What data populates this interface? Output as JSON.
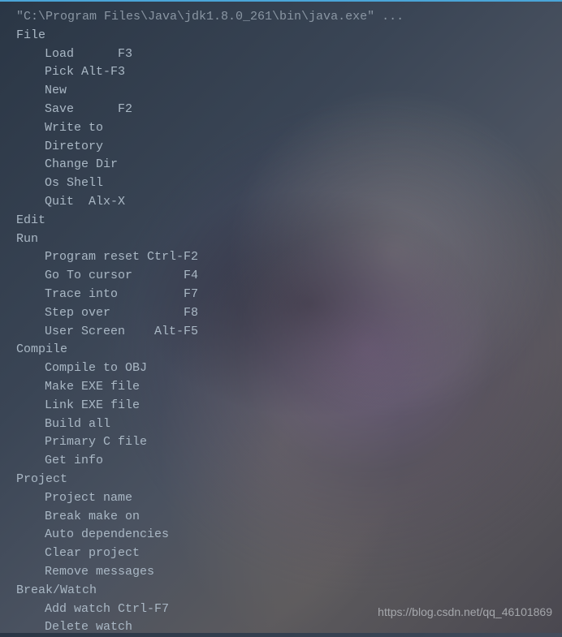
{
  "header": "\"C:\\Program Files\\Java\\jdk1.8.0_261\\bin\\java.exe\" ...",
  "sections": [
    {
      "name": "File",
      "items": [
        {
          "label": "Load",
          "shortcut": "F3",
          "col": 10
        },
        {
          "label": "Pick",
          "shortcut": "Alt-F3",
          "col": 5
        },
        {
          "label": "New",
          "shortcut": "",
          "col": 0
        },
        {
          "label": "Save",
          "shortcut": "F2",
          "col": 10
        },
        {
          "label": "Write to",
          "shortcut": "",
          "col": 0
        },
        {
          "label": "Diretory",
          "shortcut": "",
          "col": 0
        },
        {
          "label": "Change Dir",
          "shortcut": "",
          "col": 0
        },
        {
          "label": "Os Shell",
          "shortcut": "",
          "col": 0
        },
        {
          "label": "Quit",
          "shortcut": "Alx-X",
          "col": 6
        }
      ]
    },
    {
      "name": "Edit",
      "items": []
    },
    {
      "name": "Run",
      "items": [
        {
          "label": "Program reset",
          "shortcut": "Ctrl-F2",
          "col": 14
        },
        {
          "label": "Go To cursor",
          "shortcut": "F4",
          "col": 19
        },
        {
          "label": "Trace into",
          "shortcut": "F7",
          "col": 19
        },
        {
          "label": "Step over",
          "shortcut": "F8",
          "col": 19
        },
        {
          "label": "User Screen",
          "shortcut": "Alt-F5",
          "col": 15
        }
      ]
    },
    {
      "name": "Compile",
      "items": [
        {
          "label": "Compile to OBJ",
          "shortcut": "",
          "col": 0
        },
        {
          "label": "Make EXE file",
          "shortcut": "",
          "col": 0
        },
        {
          "label": "Link EXE file",
          "shortcut": "",
          "col": 0
        },
        {
          "label": "Build all",
          "shortcut": "",
          "col": 0
        },
        {
          "label": "Primary C file",
          "shortcut": "",
          "col": 0
        },
        {
          "label": "Get info",
          "shortcut": "",
          "col": 0
        }
      ]
    },
    {
      "name": "Project",
      "items": [
        {
          "label": "Project name",
          "shortcut": "",
          "col": 0
        },
        {
          "label": "Break make on",
          "shortcut": "",
          "col": 0
        },
        {
          "label": "Auto dependencies",
          "shortcut": "",
          "col": 0
        },
        {
          "label": "Clear project",
          "shortcut": "",
          "col": 0
        },
        {
          "label": "Remove messages",
          "shortcut": "",
          "col": 0
        }
      ]
    },
    {
      "name": "Break/Watch",
      "items": [
        {
          "label": "Add watch",
          "shortcut": "Ctrl-F7",
          "col": 10
        },
        {
          "label": "Delete watch",
          "shortcut": "",
          "col": 0
        }
      ]
    }
  ],
  "watermark": "https://blog.csdn.net/qq_46101869"
}
